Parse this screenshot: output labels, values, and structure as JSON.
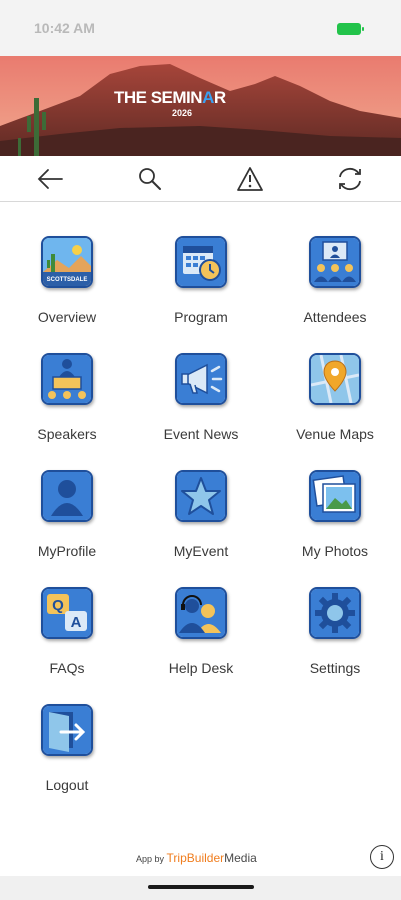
{
  "status": {
    "time": "10:42 AM"
  },
  "banner": {
    "title_main": "THE SEMIN",
    "title_accent": "A",
    "title_end": "R",
    "year": "2026"
  },
  "toolbar": {
    "back_icon": "arrow-left-icon",
    "search_icon": "search-icon",
    "alert_icon": "warning-triangle-icon",
    "refresh_icon": "refresh-icon"
  },
  "menu": [
    {
      "label": "Overview",
      "icon": "overview-icon"
    },
    {
      "label": "Program",
      "icon": "calendar-clock-icon"
    },
    {
      "label": "Attendees",
      "icon": "attendees-icon"
    },
    {
      "label": "Speakers",
      "icon": "speaker-podium-icon"
    },
    {
      "label": "Event News",
      "icon": "megaphone-icon"
    },
    {
      "label": "Venue Maps",
      "icon": "map-pin-icon"
    },
    {
      "label": "MyProfile",
      "icon": "profile-icon"
    },
    {
      "label": "MyEvent",
      "icon": "star-icon"
    },
    {
      "label": "My Photos",
      "icon": "photos-icon"
    },
    {
      "label": "FAQs",
      "icon": "qa-icon"
    },
    {
      "label": "Help Desk",
      "icon": "headset-icon"
    },
    {
      "label": "Settings",
      "icon": "gear-icon"
    },
    {
      "label": "Logout",
      "icon": "logout-icon"
    }
  ],
  "overview_icon_text": "SCOTTSDALE",
  "footer": {
    "app_by": "App by",
    "brand_a": "TripBuilder",
    "brand_b": "Media",
    "info_icon": "info-icon"
  },
  "colors": {
    "icon_border": "#1f4f9b",
    "icon_bg": "#dbe9f7",
    "battery": "#22c34a",
    "brand_orange": "#f07d1e"
  }
}
